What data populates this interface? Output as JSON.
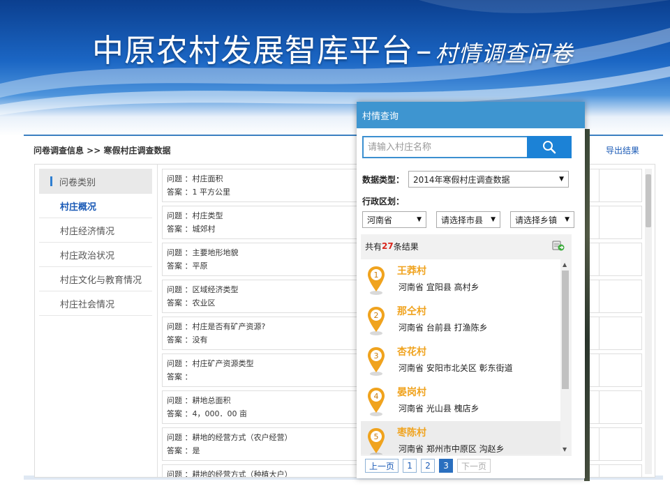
{
  "slide": {
    "title_main": "中原农村发展智库平台",
    "title_dash": "–",
    "title_sub": "村情调查问卷"
  },
  "app": {
    "breadcrumb": "问卷调查信息 >> 寒假村庄调查数据",
    "export_label": "导出结果",
    "categories": {
      "header": "问卷类别",
      "items": [
        "村庄概况",
        "村庄经济情况",
        "村庄政治状况",
        "村庄文化与教育情况",
        "村庄社会情况"
      ]
    },
    "qa": [
      {
        "q": "问题 ：村庄面积",
        "a": "答案 ：1 平方公里"
      },
      {
        "q": "问题 ：村庄类型",
        "a": "答案 ：城郊村"
      },
      {
        "q": "问题 ：主要地形地貌",
        "a": "答案 ：平原"
      },
      {
        "q": "问题 ：区域经济类型",
        "a": "答案 ：农业区"
      },
      {
        "q": "问题 ：村庄是否有矿产资源?",
        "a": "答案 ：没有"
      },
      {
        "q": "问题 ：村庄矿产资源类型",
        "a": "答案 ："
      },
      {
        "q": "问题 ：耕地总面积",
        "a": "答案 ：4，000．00 亩"
      },
      {
        "q": "问题 ：耕地的经营方式（农户经营）",
        "a": "答案 ：是"
      },
      {
        "q": "问题 ：耕地的经营方式（种植大户）",
        "a": ""
      }
    ]
  },
  "popup": {
    "title": "村情查询",
    "search_placeholder": "请输入村庄名称",
    "data_type_label": "数据类型：",
    "data_type_value": "2014年寒假村庄调查数据",
    "region_label": "行政区划：",
    "province": "河南省",
    "city": "请选择市县",
    "town": "请选择乡镇",
    "results_prefix": "共有",
    "results_count": "27",
    "results_suffix": "条结果",
    "results": [
      {
        "num": "1",
        "name": "王莽村",
        "loc": "河南省  宜阳县  高村乡"
      },
      {
        "num": "2",
        "name": "那仝村",
        "loc": "河南省  台前县  打渔陈乡"
      },
      {
        "num": "3",
        "name": "杏花村",
        "loc": "河南省  安阳市北关区  彰东街道"
      },
      {
        "num": "4",
        "name": "晏岗村",
        "loc": "河南省  光山县  槐店乡"
      },
      {
        "num": "5",
        "name": "枣陈村",
        "loc": "河南省  郑州市中原区  沟赵乡"
      }
    ],
    "pager": {
      "prev": "上一页",
      "pages": [
        "1",
        "2",
        "3"
      ],
      "current": "3",
      "next": "下一页"
    }
  },
  "colors": {
    "accent": "#3e95d0",
    "pin": "#f0a31e",
    "count": "#d9261c"
  }
}
